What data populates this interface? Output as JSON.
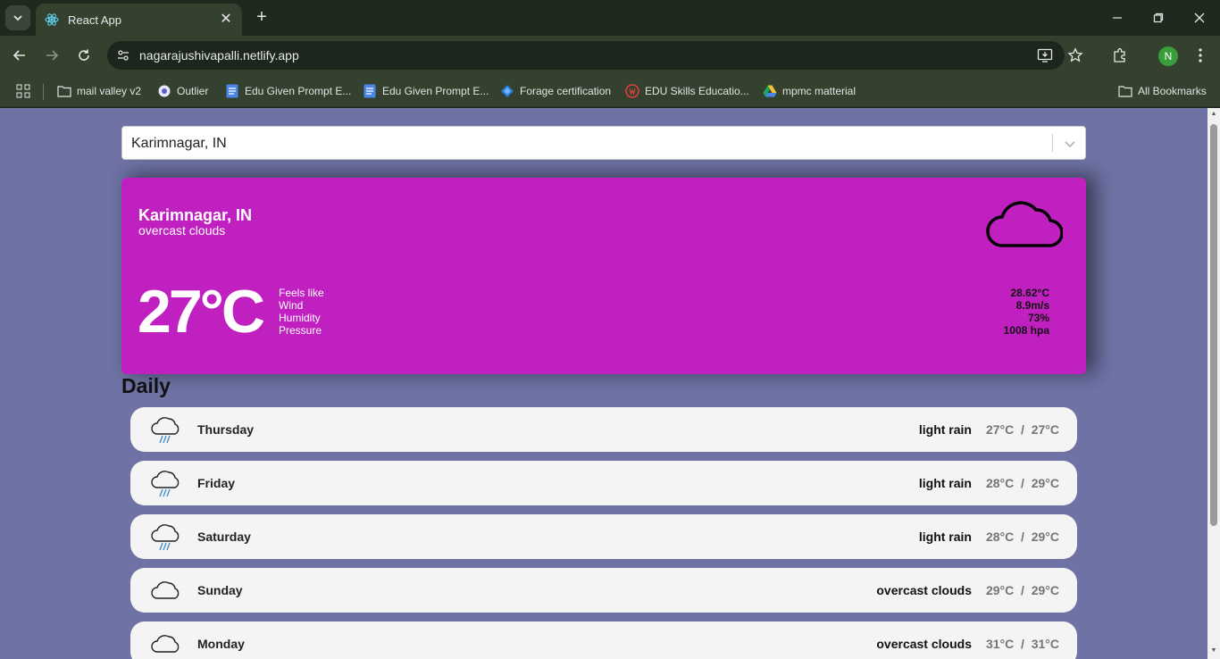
{
  "browser": {
    "tab_title": "React App",
    "url": "nagarajushivapalli.netlify.app",
    "profile_initial": "N",
    "bookmarks": [
      {
        "label": "mail valley v2",
        "icon": "folder-icon"
      },
      {
        "label": "Outlier",
        "icon": "outlier-icon"
      },
      {
        "label": "Edu Given Prompt E...",
        "icon": "docs-icon"
      },
      {
        "label": "Edu Given Prompt E...",
        "icon": "docs-icon"
      },
      {
        "label": "Forage certification",
        "icon": "forage-icon"
      },
      {
        "label": "EDU Skills Educatio...",
        "icon": "edu-skills-icon"
      },
      {
        "label": "mpmc matterial",
        "icon": "drive-icon"
      }
    ],
    "all_bookmarks_label": "All Bookmarks"
  },
  "search": {
    "selected_city": "Karimnagar, IN"
  },
  "current": {
    "city": "Karimnagar, IN",
    "description": "overcast clouds",
    "temperature": "27°C",
    "icon": "cloud-icon",
    "details": {
      "labels": [
        "Feels like",
        "Wind",
        "Humidity",
        "Pressure"
      ],
      "values": [
        "28.62°C",
        "8.9m/s",
        "73%",
        "1008 hpa"
      ]
    }
  },
  "daily": {
    "title": "Daily",
    "days": [
      {
        "day": "Thursday",
        "description": "light rain",
        "temp": "27°C  /  27°C",
        "icon": "rain-cloud-icon"
      },
      {
        "day": "Friday",
        "description": "light rain",
        "temp": "28°C  /  29°C",
        "icon": "rain-cloud-icon"
      },
      {
        "day": "Saturday",
        "description": "light rain",
        "temp": "28°C  /  29°C",
        "icon": "rain-cloud-icon"
      },
      {
        "day": "Sunday",
        "description": "overcast clouds",
        "temp": "29°C  /  29°C",
        "icon": "cloud-icon"
      },
      {
        "day": "Monday",
        "description": "overcast clouds",
        "temp": "31°C  /  31°C",
        "icon": "cloud-icon"
      }
    ]
  }
}
